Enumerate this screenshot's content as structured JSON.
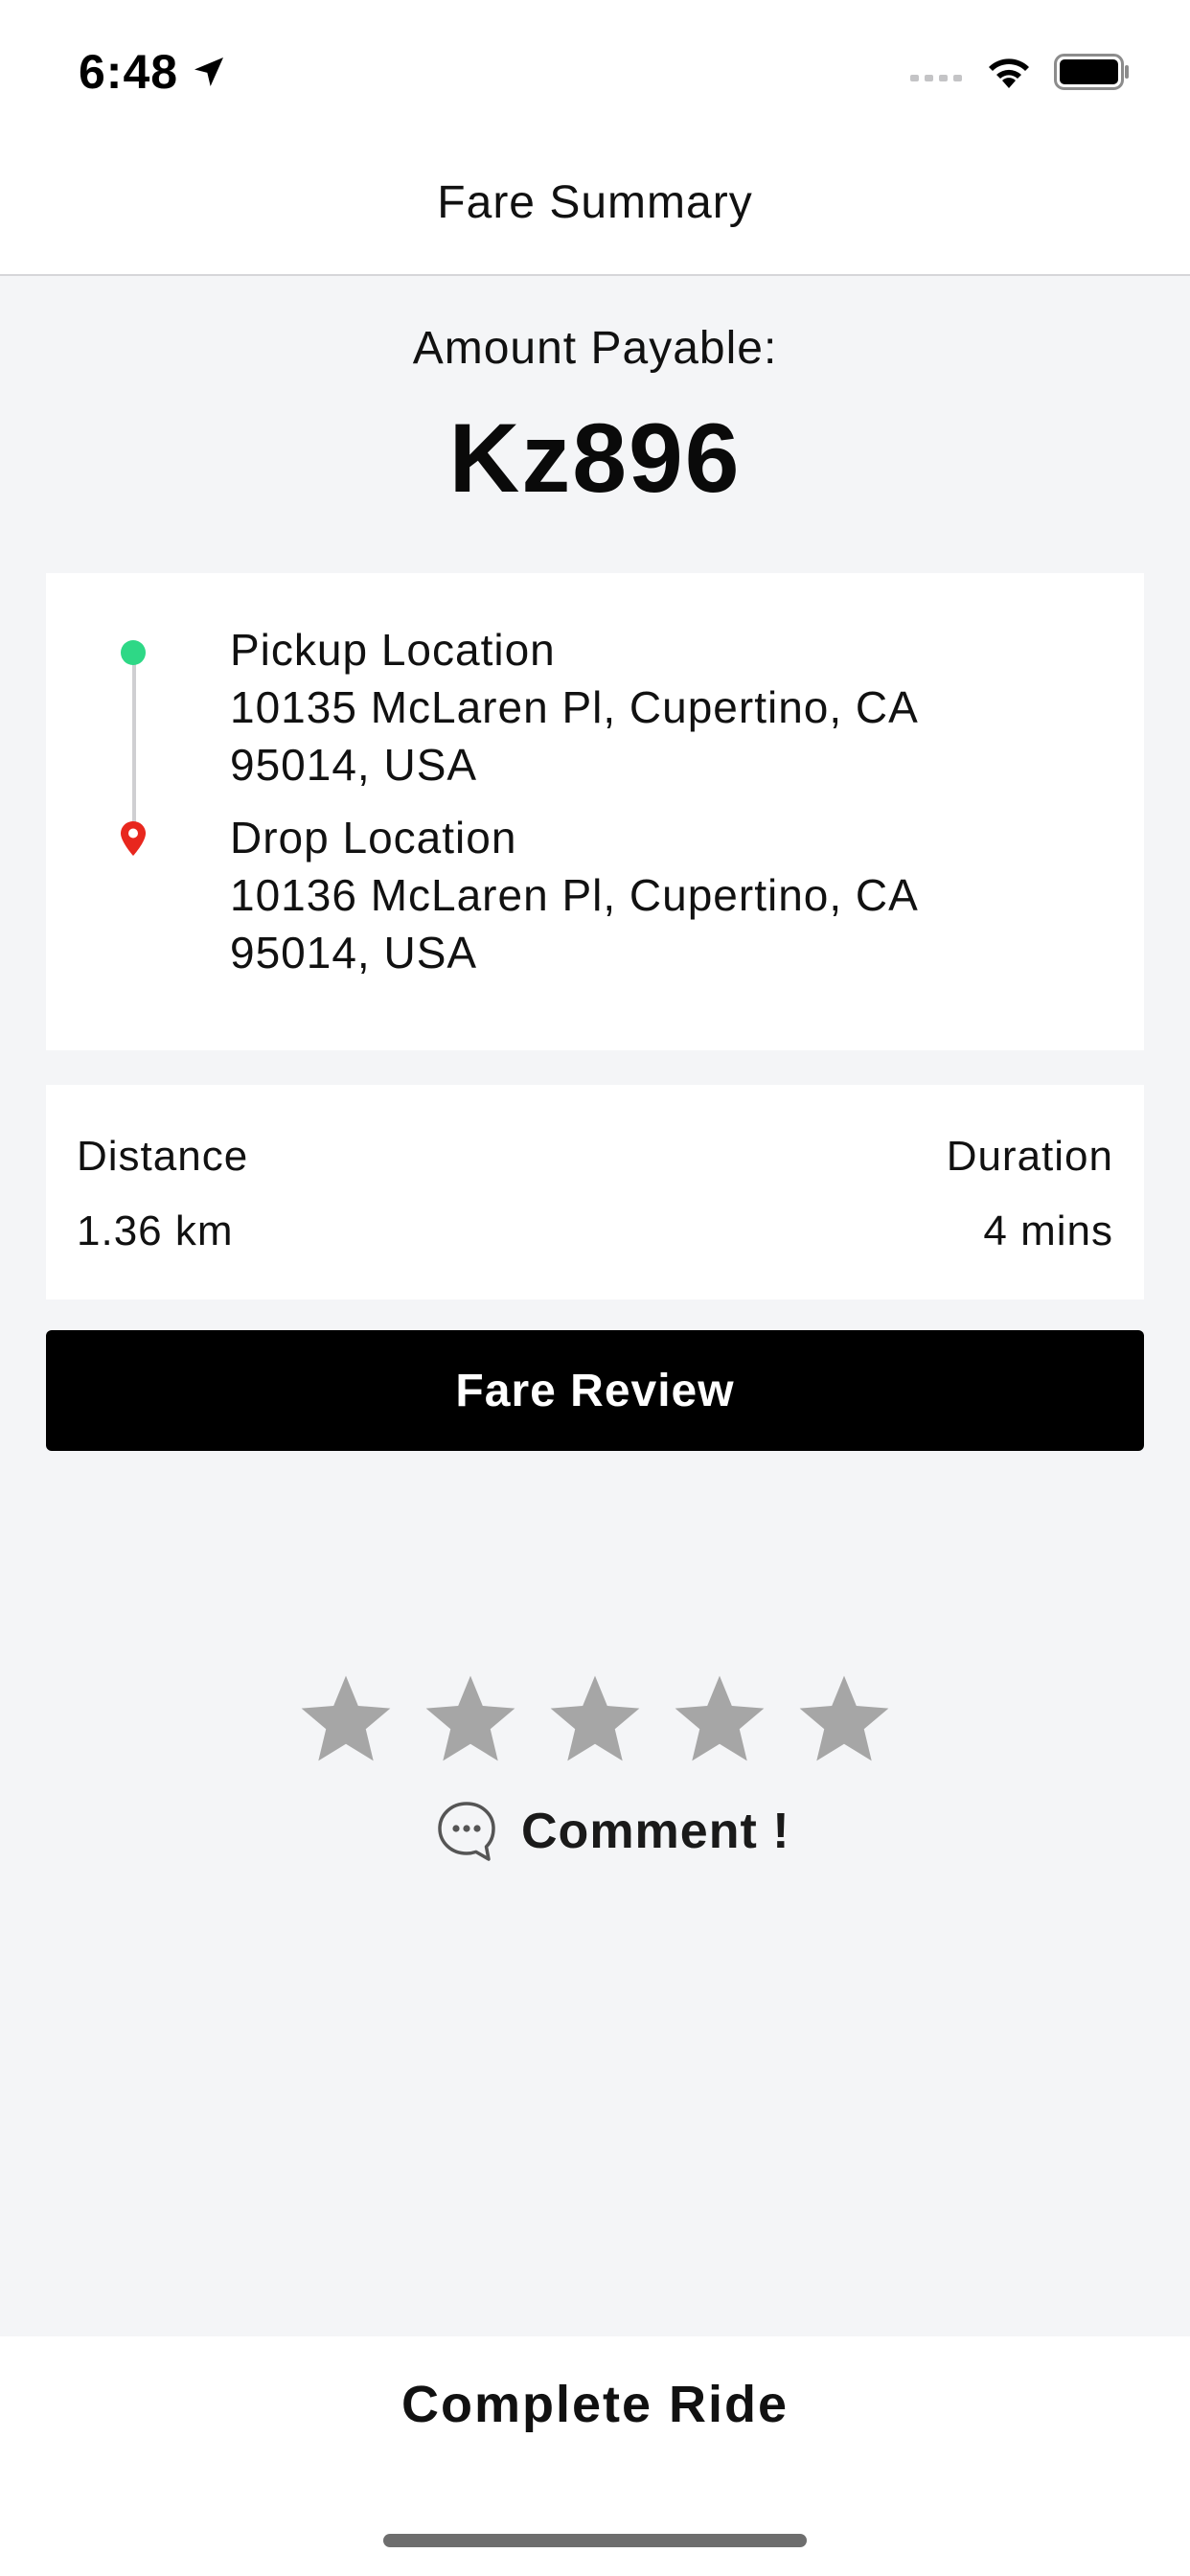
{
  "status_bar": {
    "time": "6:48"
  },
  "nav": {
    "title": "Fare Summary"
  },
  "fare": {
    "amount_label": "Amount Payable:",
    "amount_value": "Kz896"
  },
  "route": {
    "pickup_title": "Pickup Location",
    "pickup_address_line1": "10135 McLaren Pl, Cupertino, CA",
    "pickup_address_line2": "95014, USA",
    "drop_title": "Drop Location",
    "drop_address_line1": "10136 McLaren Pl, Cupertino, CA",
    "drop_address_line2": "95014, USA"
  },
  "stats": {
    "distance_label": "Distance",
    "distance_value": "1.36 km",
    "duration_label": "Duration",
    "duration_value": "4 mins"
  },
  "actions": {
    "fare_review_label": "Fare Review",
    "comment_label": "Comment !",
    "complete_ride_label": "Complete Ride"
  },
  "rating": {
    "max_stars": 5,
    "selected": 0
  },
  "colors": {
    "pickup": "#2ED886",
    "drop": "#E8271E",
    "star_inactive": "#A6A6A6",
    "primary_button": "#000000"
  },
  "icons": {
    "location_arrow": "location-arrow-icon",
    "signal": "cellular-signal-icon",
    "wifi": "wifi-icon",
    "battery": "battery-icon",
    "pickup": "pickup-dot-icon",
    "drop": "map-pin-icon",
    "star": "star-icon",
    "comment": "chat-bubble-icon"
  }
}
